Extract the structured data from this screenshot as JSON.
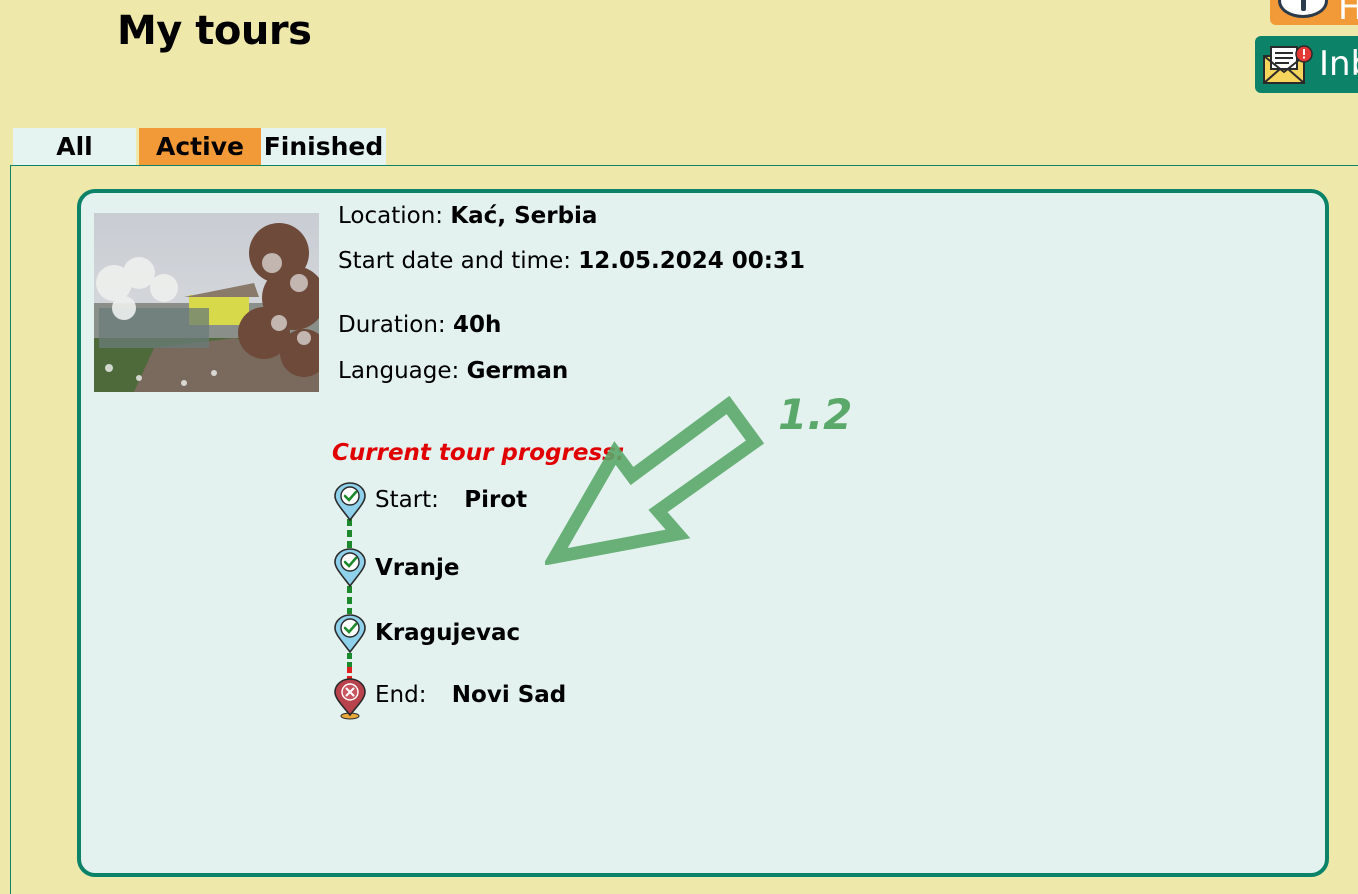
{
  "page": {
    "title": "My tours"
  },
  "header": {
    "help_label": "H",
    "inbox_label": "Inb"
  },
  "tabs": [
    {
      "label": "All",
      "selected": false
    },
    {
      "label": "Active",
      "selected": true
    },
    {
      "label": "Finished",
      "selected": false
    }
  ],
  "tour": {
    "location_label": "Location:",
    "location_value": "Kać, Serbia",
    "start_label": "Start date and time:",
    "start_value": "12.05.2024 00:31",
    "duration_label": "Duration:",
    "duration_value": "40h",
    "language_label": "Language:",
    "language_value": "German",
    "progress_title": "Current tour progress:",
    "stops": [
      {
        "prefix": "Start:",
        "city": "Pirot",
        "status": "completed",
        "icon": "check-pin-icon"
      },
      {
        "prefix": "",
        "city": "Vranje",
        "status": "completed",
        "icon": "check-pin-icon"
      },
      {
        "prefix": "",
        "city": "Kragujevac",
        "status": "completed",
        "icon": "check-pin-icon"
      },
      {
        "prefix": "End:",
        "city": "Novi Sad",
        "status": "pending",
        "icon": "cross-pin-icon"
      }
    ]
  },
  "annotation": {
    "label": "1.2",
    "color": "#5aa86a"
  },
  "colors": {
    "background": "#eee8aa",
    "accent_green": "#0c8368",
    "accent_orange": "#f39a38",
    "card_bg": "#e4f2ef",
    "progress_title": "#e00000"
  }
}
